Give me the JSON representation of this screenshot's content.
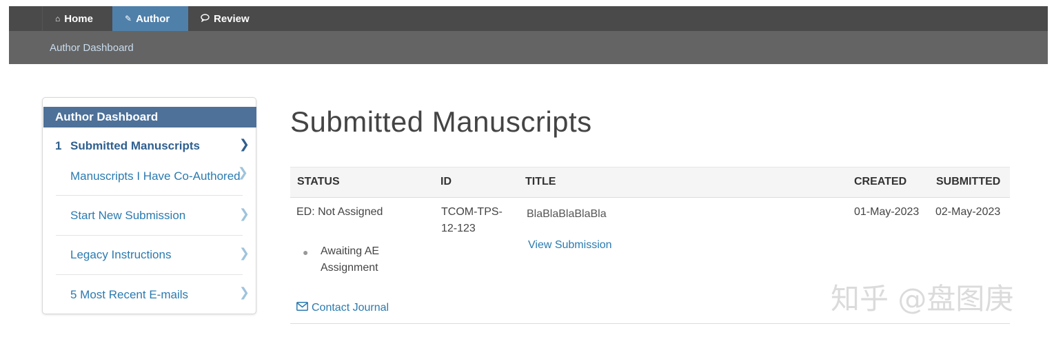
{
  "topnav": {
    "tabs": [
      {
        "label": "Home",
        "icon": "home-icon",
        "active": false
      },
      {
        "label": "Author",
        "icon": "pencil-icon",
        "active": true
      },
      {
        "label": "Review",
        "icon": "comment-icon",
        "active": false
      }
    ]
  },
  "subnav": {
    "link": "Author Dashboard"
  },
  "sidebar": {
    "title": "Author Dashboard",
    "items": [
      {
        "number": "1",
        "label": "Submitted Manuscripts",
        "active": true
      },
      {
        "number": "",
        "label": "Manuscripts I Have Co-Authored",
        "active": false
      },
      {
        "number": "",
        "label": "Start New Submission",
        "active": false
      },
      {
        "number": "",
        "label": "Legacy Instructions",
        "active": false
      },
      {
        "number": "",
        "label": "5 Most Recent E-mails",
        "active": false
      }
    ]
  },
  "main": {
    "title": "Submitted Manuscripts",
    "columns": [
      "STATUS",
      "ID",
      "TITLE",
      "CREATED",
      "SUBMITTED"
    ],
    "rows": [
      {
        "status": "ED: Not Assigned",
        "status_detail_line1": "Awaiting AE",
        "status_detail_line2": "Assignment",
        "contact": "Contact Journal",
        "id_line1": "TCOM-TPS-",
        "id_line2": "12-123",
        "title": "BlaBlaBlaBlaBla",
        "view_link": "View Submission",
        "created": "01-May-2023",
        "submitted": "02-May-2023"
      }
    ]
  },
  "watermark": "知乎 @盘图庚",
  "colors": {
    "topnav_bg": "#4a4a4a",
    "active_tab": "#4f80aa",
    "subnav_bg": "#646464",
    "sidebar_header": "#4d7199",
    "link": "#2a7ab0"
  }
}
